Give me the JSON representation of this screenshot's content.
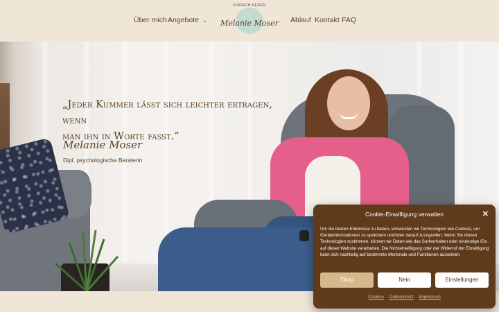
{
  "nav": {
    "left": [
      "Über mich",
      "Angebote"
    ],
    "right": [
      "Ablauf",
      "Kontakt",
      "FAQ"
    ],
    "dropdown_icon": "chevron-down-icon"
  },
  "logo": {
    "tagline": "EINFACH REDEN",
    "name": "Melanie Moser"
  },
  "hero": {
    "quote_line1": "„Jeder Kummer lässt sich leichter ertragen, wenn",
    "quote_line2": "man ihn in Worte fasst.“",
    "signature": "Melanie Moser",
    "subtitle": "Dipl. psychologische Beraterin"
  },
  "consent": {
    "title": "Cookie-Einwilligung verwalten",
    "body": "Um die besten Erlebnisse zu bieten, verwenden wir Technologien wie Cookies, um Geräteinformationen zu speichern und/oder darauf zuzugreifen. Wenn Sie diesen Technologien zustimmen, können wir Daten wie das Surfverhalten oder eindeutige IDs auf dieser Website verarbeiten. Die Nichteinwilligung oder der Widerruf der Einwilligung kann sich nachteilig auf bestimmte Merkmale und Funktionen auswirken.",
    "buttons": {
      "accept": "Okay",
      "deny": "Nein",
      "settings": "Einstellungen"
    },
    "links": [
      "Cookies",
      "Datenschutz",
      "Impressum"
    ]
  },
  "colors": {
    "brand_brown": "#5b3f22",
    "background": "#efe6d8",
    "consent_bg": "#5f3a1b",
    "accept_button": "#d4b98c"
  }
}
